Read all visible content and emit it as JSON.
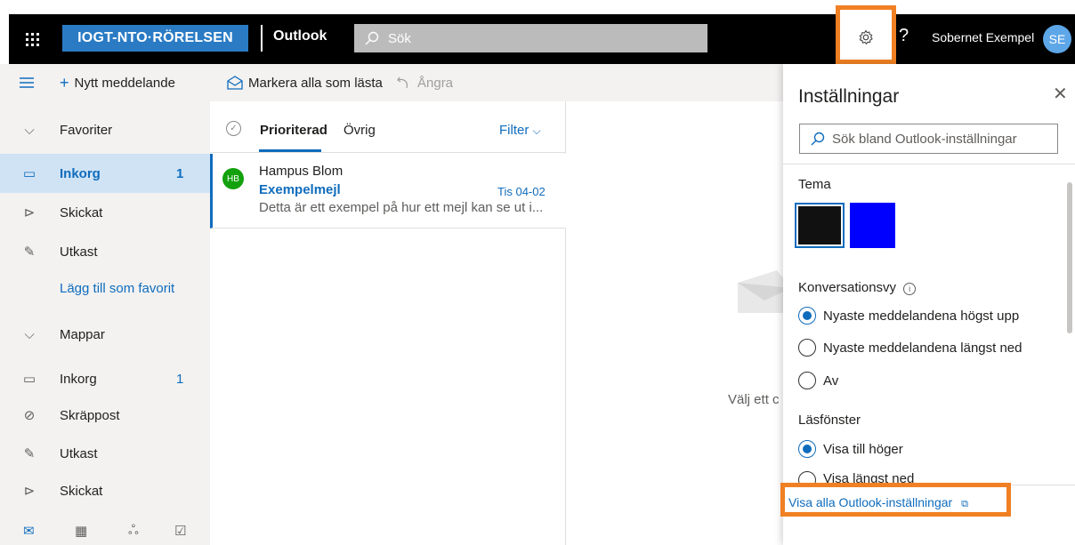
{
  "header": {
    "brand": "IOGT-NTO·RÖRELSEN",
    "app_name": "Outlook",
    "search_placeholder": "Sök",
    "help": "?",
    "user_name": "Sobernet Exempel",
    "user_initials": "SE"
  },
  "toolbar": {
    "new_message": "Nytt meddelande",
    "mark_all_read": "Markera alla som lästa",
    "undo": "Ångra"
  },
  "nav": {
    "favorites_header": "Favoriter",
    "favorites": [
      {
        "label": "Inkorg",
        "count": "1",
        "icon": "inbox-icon"
      },
      {
        "label": "Skickat",
        "count": "",
        "icon": "send-icon"
      },
      {
        "label": "Utkast",
        "count": "",
        "icon": "pencil-icon"
      }
    ],
    "add_favorite": "Lägg till som favorit",
    "folders_header": "Mappar",
    "folders": [
      {
        "label": "Inkorg",
        "count": "1",
        "icon": "inbox-icon"
      },
      {
        "label": "Skräppost",
        "count": "",
        "icon": "block-icon"
      },
      {
        "label": "Utkast",
        "count": "",
        "icon": "pencil-icon"
      },
      {
        "label": "Skickat",
        "count": "",
        "icon": "send-icon"
      }
    ]
  },
  "message_list": {
    "tab_focused": "Prioriterad",
    "tab_other": "Övrig",
    "filter": "Filter",
    "messages": [
      {
        "initials": "HB",
        "sender": "Hampus Blom",
        "subject": "Exempelmejl",
        "date": "Tis 04-02",
        "preview": "Detta är ett exempel på hur ett mejl kan se ut i..."
      }
    ]
  },
  "reading_pane": {
    "empty_text": "Välj ett c"
  },
  "settings": {
    "title": "Inställningar",
    "search_placeholder": "Sök bland Outlook-inställningar",
    "theme_label": "Tema",
    "theme_colors": [
      "#111111",
      "#0000ff"
    ],
    "conversation_label": "Konversationsvy",
    "conversation_options": [
      {
        "label": "Nyaste meddelandena högst upp",
        "selected": true
      },
      {
        "label": "Nyaste meddelandena längst ned",
        "selected": false
      },
      {
        "label": "Av",
        "selected": false
      }
    ],
    "reading_pane_label": "Läsfönster",
    "reading_pane_options": [
      {
        "label": "Visa till höger",
        "selected": true
      },
      {
        "label": "Visa längst ned",
        "selected": false
      }
    ],
    "view_all": "Visa alla Outlook-inställningar"
  },
  "colors": {
    "accent": "#0f6cbd",
    "highlight": "#f08023",
    "brand_bg": "#2a7bc4"
  }
}
